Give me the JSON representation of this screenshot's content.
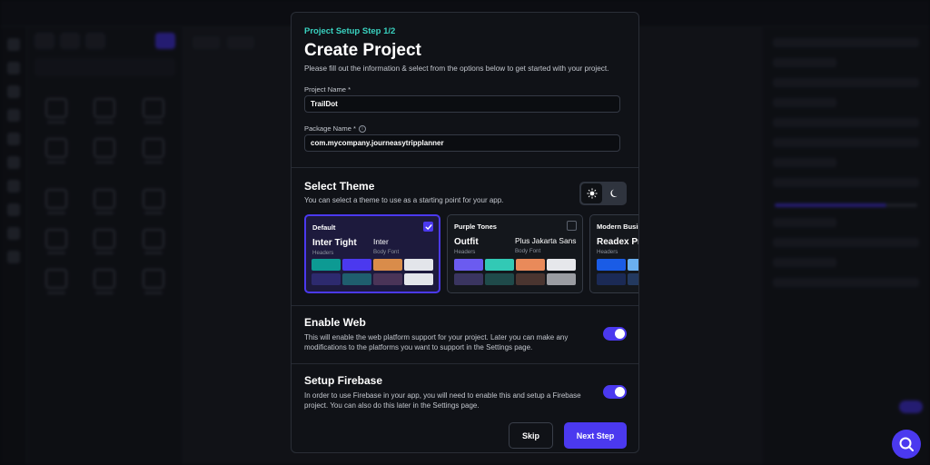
{
  "modal": {
    "step_label": "Project Setup Step 1/2",
    "title": "Create Project",
    "subtitle": "Please fill out the information & select from the options below to get started with your project.",
    "project_name": {
      "label": "Project Name *",
      "value": "TrailDot"
    },
    "package_name": {
      "label": "Package Name *",
      "value": "com.mycompany.journeasytripplanner",
      "info_icon": "info-icon"
    },
    "theme": {
      "title": "Select Theme",
      "description": "You can select a theme to use as a starting point for your app.",
      "mode_icons": {
        "light": "sun-icon",
        "dark": "moon-icon"
      },
      "cards": [
        {
          "name": "Default",
          "header_font": "Inter Tight",
          "header_label": "Headers",
          "body_font": "Inter",
          "body_label": "Body Font",
          "selected": true,
          "swatches": [
            "#0d9a93",
            "#4b39ef",
            "#d98c4a",
            "#e3e5ea",
            "#2d2a6e",
            "#1f5e6e",
            "#4a3458",
            "#e3e5ea"
          ]
        },
        {
          "name": "Purple Tones",
          "header_font": "Outfit",
          "header_label": "Headers",
          "body_font": "Plus Jakarta Sans",
          "body_label": "Body Font",
          "selected": false,
          "swatches": [
            "#6b5bf0",
            "#32c9b5",
            "#e98a5a",
            "#e6e7eb",
            "#3a3560",
            "#1f4a4a",
            "#4a3530",
            "#9a9ca2"
          ]
        },
        {
          "name": "Modern Business",
          "header_font": "Readex Pro",
          "header_label": "Headers",
          "body_font": "",
          "body_label": "",
          "selected": false,
          "swatches": [
            "#1a5ce6",
            "#6ab0f0",
            "#1a5ce6",
            "#6ab0f0",
            "#1b2a55",
            "#23395f",
            "#1b2a55",
            "#23395f"
          ]
        }
      ]
    },
    "web": {
      "title": "Enable Web",
      "description": "This will enable the web platform support for your project. Later you can make any modifications to the platforms you want to support in the Settings page.",
      "enabled": true
    },
    "firebase": {
      "title": "Setup Firebase",
      "description": "In order to use Firebase in your app, you will need to enable this and setup a Firebase project. You can also do this later in the Settings page.",
      "enabled": true
    },
    "buttons": {
      "skip": "Skip",
      "next": "Next Step"
    }
  },
  "colors": {
    "accent": "#4b39ef",
    "step": "#39d2c0",
    "modal_bg": "#101217"
  },
  "fab_icon": "search-icon"
}
